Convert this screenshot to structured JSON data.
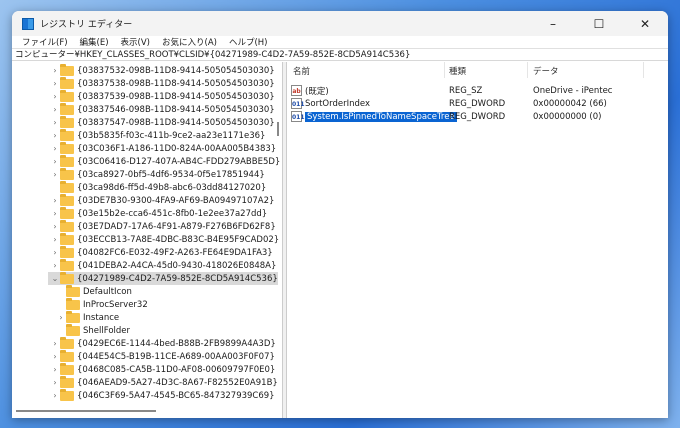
{
  "window": {
    "title": "レジストリ エディター",
    "minimize": "–",
    "maximize": "☐",
    "close": "✕"
  },
  "menu": [
    "ファイル(F)",
    "編集(E)",
    "表示(V)",
    "お気に入り(A)",
    "ヘルプ(H)"
  ],
  "address": "コンピューター¥HKEY_CLASSES_ROOT¥CLSID¥{04271989-C4D2-7A59-852E-8CD5A914C536}",
  "tree": [
    {
      "label": "{03837532-098B-11D8-9414-505054503030}",
      "level": 0,
      "expander": "collapsed"
    },
    {
      "label": "{03837538-098B-11D8-9414-505054503030}",
      "level": 0,
      "expander": "collapsed"
    },
    {
      "label": "{03837539-098B-11D8-9414-505054503030}",
      "level": 0,
      "expander": "collapsed"
    },
    {
      "label": "{03837546-098B-11D8-9414-505054503030}",
      "level": 0,
      "expander": "collapsed"
    },
    {
      "label": "{03837547-098B-11D8-9414-505054503030}",
      "level": 0,
      "expander": "collapsed"
    },
    {
      "label": "{03b5835f-f03c-411b-9ce2-aa23e1171e36}",
      "level": 0,
      "expander": "collapsed"
    },
    {
      "label": "{03C036F1-A186-11D0-824A-00AA005B4383}",
      "level": 0,
      "expander": "collapsed"
    },
    {
      "label": "{03C06416-D127-407A-AB4C-FDD279ABBE5D}",
      "level": 0,
      "expander": "collapsed"
    },
    {
      "label": "{03ca8927-0bf5-4df6-9534-0f5e17851944}",
      "level": 0,
      "expander": "collapsed"
    },
    {
      "label": "{03ca98d6-ff5d-49b8-abc6-03dd84127020}",
      "level": 0,
      "expander": "none"
    },
    {
      "label": "{03DE7B30-9300-4FA9-AF69-BA09497107A2}",
      "level": 0,
      "expander": "collapsed"
    },
    {
      "label": "{03e15b2e-cca6-451c-8fb0-1e2ee37a27dd}",
      "level": 0,
      "expander": "collapsed"
    },
    {
      "label": "{03E7DAD7-17A6-4F91-A879-F276B6FD62F8}",
      "level": 0,
      "expander": "collapsed"
    },
    {
      "label": "{03ECCB13-7A8E-4DBC-B83C-B4E95F9CAD02}",
      "level": 0,
      "expander": "collapsed"
    },
    {
      "label": "{04082FC6-E032-49F2-A263-FE64E9DA1FA3}",
      "level": 0,
      "expander": "collapsed"
    },
    {
      "label": "{041DEBA2-A4CA-45d0-9430-418026E0848A}",
      "level": 0,
      "expander": "collapsed"
    },
    {
      "label": "{04271989-C4D2-7A59-852E-8CD5A914C536}",
      "level": 0,
      "expander": "expanded",
      "selected": true
    },
    {
      "label": "DefaultIcon",
      "level": 1,
      "expander": "none"
    },
    {
      "label": "InProcServer32",
      "level": 1,
      "expander": "none"
    },
    {
      "label": "Instance",
      "level": 1,
      "expander": "collapsed"
    },
    {
      "label": "ShellFolder",
      "level": 1,
      "expander": "none"
    },
    {
      "label": "{0429EC6E-1144-4bed-B88B-2FB9899A4A3D}",
      "level": 0,
      "expander": "collapsed"
    },
    {
      "label": "{044E54C5-B19B-11CE-A689-00AA003F0F07}",
      "level": 0,
      "expander": "collapsed"
    },
    {
      "label": "{0468C085-CA5B-11D0-AF08-00609797F0E0}",
      "level": 0,
      "expander": "collapsed"
    },
    {
      "label": "{046AEAD9-5A27-4D3C-8A67-F82552E0A91B}",
      "level": 0,
      "expander": "collapsed"
    },
    {
      "label": "{046C3F69-5A47-4545-BC65-847327939C69}",
      "level": 0,
      "expander": "collapsed"
    }
  ],
  "columns": {
    "name": "名前",
    "type": "種類",
    "data": "データ"
  },
  "values": [
    {
      "icon": "ab",
      "name": "(既定)",
      "type": "REG_SZ",
      "data": "OneDrive - iPentec"
    },
    {
      "icon": "011",
      "name": "SortOrderIndex",
      "type": "REG_DWORD",
      "data": "0x00000042 (66)"
    },
    {
      "icon": "011",
      "name": "System.IsPinnedToNameSpaceTree",
      "type": "REG_DWORD",
      "data": "0x00000000 (0)",
      "selected": true
    }
  ]
}
